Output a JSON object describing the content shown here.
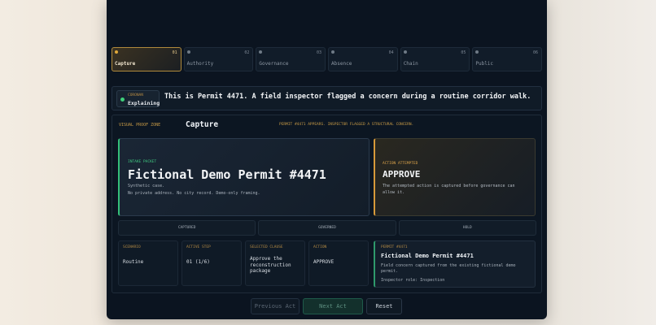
{
  "tabs": [
    {
      "num": "01",
      "label": "Capture",
      "active": true
    },
    {
      "num": "02",
      "label": "Authority",
      "active": false
    },
    {
      "num": "03",
      "label": "Governance",
      "active": false
    },
    {
      "num": "04",
      "label": "Absence",
      "active": false
    },
    {
      "num": "05",
      "label": "Chain",
      "active": false
    },
    {
      "num": "06",
      "label": "Public",
      "active": false
    }
  ],
  "narration": {
    "badge_label": "CORONAN",
    "badge_status": "Explaining",
    "message": "This is Permit 4471. A field inspector flagged a concern during a routine corridor walk."
  },
  "zone": {
    "label": "VISUAL PROOF ZONE",
    "title": "Capture",
    "status": "PERMIT #4471 APPEARS. INSPECTOR FLAGGED A STRUCTURAL CONCERN."
  },
  "intake": {
    "label": "INTAKE PACKET",
    "title": "Fictional Demo Permit #4471",
    "line1": "Synthetic case.",
    "line2": "No private address. No city record. Demo-only framing."
  },
  "action": {
    "label": "ACTION ATTEMPTED",
    "title": "APPROVE",
    "desc": "The attempted action is captured before governance can allow it."
  },
  "stages": [
    "CAPTURED",
    "GOVERNED",
    "HOLD"
  ],
  "details": {
    "scenario": {
      "label": "SCENARIO",
      "value": "Routine"
    },
    "step": {
      "label": "ACTIVE STEP",
      "value": "01 (1/6)"
    },
    "clause": {
      "label": "SELECTED CLAUSE",
      "value": "Approve the reconstruction package"
    },
    "action": {
      "label": "ACTION",
      "value": "APPROVE"
    }
  },
  "permit": {
    "label": "PERMIT #4471",
    "title": "Fictional Demo Permit #4471",
    "desc": "Field concern captured from the existing fictional demo permit.",
    "role": "Inspector role: Inspection"
  },
  "buttons": {
    "prev": "Previous Act",
    "next": "Next Act",
    "reset": "Reset"
  },
  "colors": {
    "panel_bg": "#0b1420",
    "accent_gold": "#e0a93a",
    "accent_green": "#34c07a",
    "accent_orange": "#d79a3a"
  }
}
